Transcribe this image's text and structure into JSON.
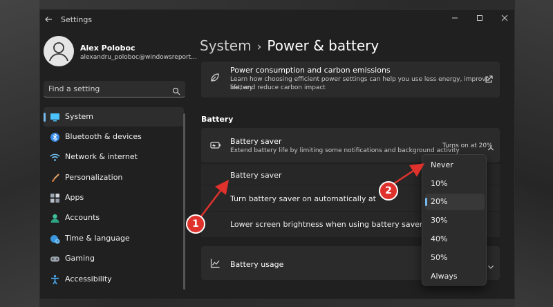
{
  "window": {
    "app_title": "Settings"
  },
  "profile": {
    "name": "Alex Poloboc",
    "email": "alexandru_poloboc@windowsreport..."
  },
  "search": {
    "placeholder": "Find a setting"
  },
  "sidebar": {
    "items": [
      {
        "label": "System",
        "icon": "monitor-icon",
        "selected": true
      },
      {
        "label": "Bluetooth & devices",
        "icon": "bluetooth-icon"
      },
      {
        "label": "Network & internet",
        "icon": "wifi-icon"
      },
      {
        "label": "Personalization",
        "icon": "brush-icon"
      },
      {
        "label": "Apps",
        "icon": "apps-icon"
      },
      {
        "label": "Accounts",
        "icon": "person-icon"
      },
      {
        "label": "Time & language",
        "icon": "globe-clock-icon"
      },
      {
        "label": "Gaming",
        "icon": "gamepad-icon"
      },
      {
        "label": "Accessibility",
        "icon": "accessibility-icon"
      }
    ]
  },
  "breadcrumb": {
    "parent": "System",
    "separator": "›",
    "current": "Power & battery"
  },
  "power_card": {
    "title": "Power consumption and carbon emissions",
    "desc_line1": "Learn how choosing efficient power settings can help you use less energy, improve battery",
    "desc_line2": "life, and reduce carbon impact"
  },
  "battery_section": {
    "label": "Battery"
  },
  "battery_saver": {
    "title": "Battery saver",
    "desc": "Extend battery life by limiting some notifications and background activity",
    "status": "Turns on at 20%",
    "rows": [
      {
        "label": "Battery saver"
      },
      {
        "label": "Turn battery saver on automatically at"
      },
      {
        "label": "Lower screen brightness when using battery saver"
      }
    ]
  },
  "battery_usage": {
    "title": "Battery usage"
  },
  "dropdown": {
    "options": [
      "Never",
      "10%",
      "20%",
      "30%",
      "40%",
      "50%",
      "Always"
    ],
    "selected": "20%"
  },
  "annotations": {
    "badge1": "1",
    "badge2": "2"
  },
  "colors": {
    "accent": "#76b9ed",
    "badge": "#e0322d",
    "window_bg": "#202020",
    "card_bg": "#2b2b2b"
  }
}
